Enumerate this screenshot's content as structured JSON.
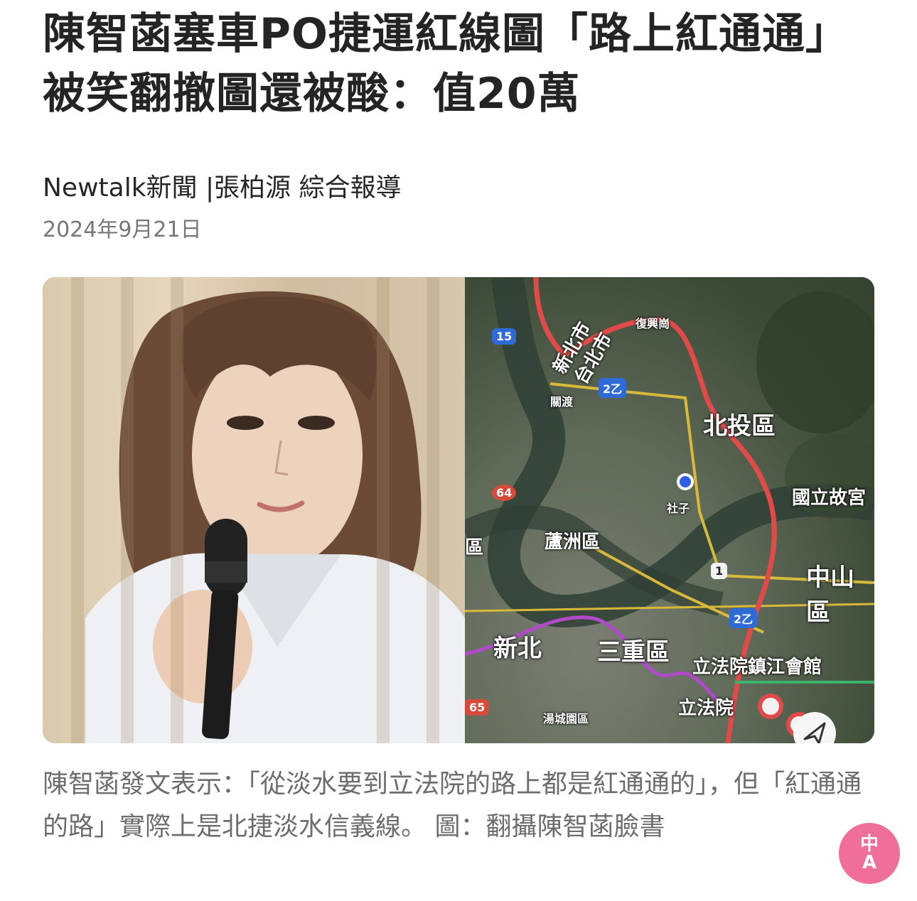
{
  "article": {
    "headline_line1": "陳智菡塞車PO捷運紅線圖「路上紅通通」",
    "headline_line2": "被笑翻撤圖還被酸：值20萬",
    "byline": "Newtalk新聞 |張柏源 綜合報導",
    "date": "2024年9月21日"
  },
  "figure": {
    "map_labels": {
      "new_taipei_city": "新北市",
      "taipei_city": "台北市",
      "fuxing_gang": "復興崗",
      "guandu": "關渡",
      "beitou": "北投區",
      "npm": "國立故宮",
      "shezi": "社子",
      "luzhou": "蘆洲區",
      "zhongshan": "中山區",
      "xinbei": "新北",
      "sanchong": "三重區",
      "zhenjiang_hall": "立法院鎮江會館",
      "legislative_yuan": "立法院",
      "tangcheng": "湯城園區",
      "district_edge": "區"
    },
    "route_shields": {
      "r15": "15",
      "r2b_top": "2乙",
      "r64": "64",
      "r1": "1",
      "r2b_bottom": "2乙",
      "r65": "65"
    }
  },
  "caption": {
    "text": "陳智菡發文表示：「從淡水要到立法院的路上都是紅通通的」，但「紅通通的路」實際上是北捷淡水信義線。 圖：翻攝陳智菡臉書"
  },
  "badge": {
    "line1": "中",
    "line2": "A"
  },
  "colors": {
    "metro_red": "#e24a4a",
    "metro_purple": "#b04ac9",
    "road_yellow": "#d8b93a",
    "badge_pink": "#ef6f9a"
  }
}
